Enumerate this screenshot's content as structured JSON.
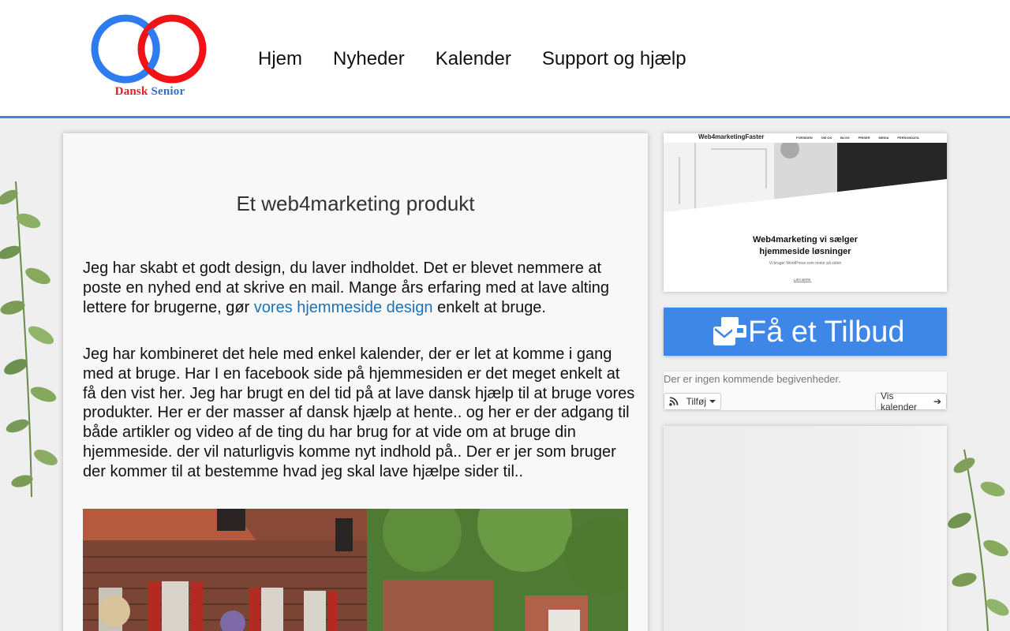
{
  "logo": {
    "word1": "Dansk",
    "word2": "Senior",
    "colors": {
      "left_ring": "#2f7cf0",
      "right_ring": "#f01216"
    }
  },
  "nav": {
    "items": [
      "Hjem",
      "Nyheder",
      "Kalender",
      "Support og hjælp"
    ]
  },
  "main": {
    "title": "Et web4marketing produkt",
    "p1_before": "Jeg har skabt et godt design, du laver indholdet. Det er blevet nemmere at poste en nyhed end at skrive en mail. Mange års erfaring med at lave alting lettere for brugerne, gør ",
    "p1_link": "vores hjemmeside design",
    "p1_after": " enkelt at bruge.",
    "p2": "Jeg har kombineret det hele med enkel kalender, der er let at komme i gang med at bruge. Har I en facebook side på hjemmesiden er det meget enkelt at få den vist her. Jeg har brugt en del tid på at lave dansk hjælp til at bruge vores produkter. Her er der masser af dansk hjælp at hente.. og her er der adgang til både artikler og video af de ting du har brug for at vide om at bruge din hjemmeside. der vil naturligvis komme nyt indhold på.. Der er jer som bruger der kommer til at bestemme hvad jeg skal lave hjælpe sider til.."
  },
  "sidebar": {
    "preview": {
      "brand": "Web4marketingFaster",
      "menu": [
        "FORSIDEN",
        "OM OS",
        "BLOG",
        "PRISER",
        "MEDIA",
        "PERSONDATA"
      ],
      "heading_line1": "Web4marketing vi sælger",
      "heading_line2": "hjemmeside løsninger",
      "sub": "Vi bruger WordPress som motor på siden",
      "button": "LÆS MERE"
    },
    "cta": {
      "label": "Få et Tilbud",
      "icon": "mail-bulk-icon",
      "color": "#3f87e6"
    },
    "events": {
      "message": "Der er ingen kommende begivenheder.",
      "add_label": "Tilføj",
      "calendar_label": "Vis kalender"
    }
  },
  "accent_color": "#3f84e0"
}
